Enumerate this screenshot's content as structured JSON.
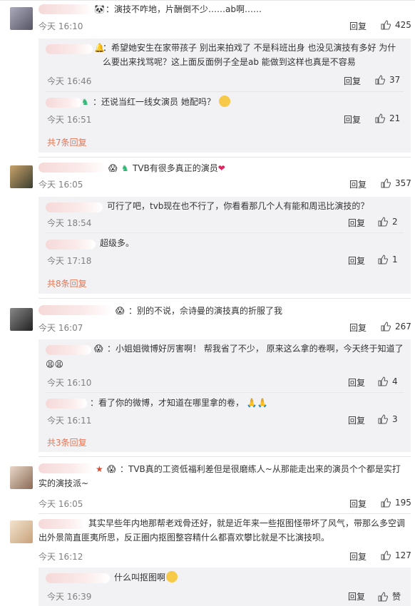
{
  "comments": [
    {
      "text": "：演技不咋地，片酬倒不少……ab啊……",
      "time": "今天 16:10",
      "reply": "回复",
      "likes": "425",
      "replies": [
        {
          "text": "：希望她安生在家带孩子 别出来拍戏了 不是科班出身 也没见演技有多好 为什么要出来找骂呢？这上面反面例子全是ab 能做到这样也真是不容易",
          "time": "今天 16:46",
          "reply": "回复",
          "likes": "37"
        },
        {
          "text": "：还说当红一线女演员 她配吗？",
          "time": "今天 16:51",
          "reply": "回复",
          "likes": "21"
        }
      ],
      "more": "共7条回复"
    },
    {
      "text": "TVB有很多真正的演员",
      "time": "今天 16:05",
      "reply": "回复",
      "likes": "357",
      "replies": [
        {
          "text": "可行了吧，tvb现在也不行了，你看看那几个人有能和周迅比演技的？",
          "time": "今天 18:54",
          "reply": "回复",
          "likes": "2"
        },
        {
          "text": "超级多。",
          "time": "今天 17:18",
          "reply": "回复",
          "likes": "1"
        }
      ],
      "more": "共8条回复"
    },
    {
      "text": "：别的不说，佘诗曼的演技真的折服了我",
      "time": "今天 16:07",
      "reply": "回复",
      "likes": "267",
      "replies": [
        {
          "text": "：小姐姐微博好厉害啊！ 帮我省了不少， 原来这么拿的卷啊，今天终于知道了",
          "time": "今天 16:10",
          "reply": "回复",
          "likes": "4"
        },
        {
          "text": "：看了你的微博，才知道在哪里拿的卷，",
          "time": "今天 16:11",
          "reply": "回复",
          "likes": "3"
        }
      ],
      "more": "共3条回复"
    },
    {
      "text": "：TVB真的工资低福利差但是很磨练人~从那能走出来的演员个个都是实打实的演技派~",
      "time": "今天 16:05",
      "reply": "回复",
      "likes": "195"
    },
    {
      "text": "其实早些年内地那帮老戏骨还好，就是近年来一些抠图怪带坏了风气，带那么多空调出外景简直匪夷所思，反正圈内抠图整容精什么都喜欢攀比就是不比演技呗。",
      "time": "今天 16:12",
      "reply": "回复",
      "likes": "127",
      "replies": [
        {
          "text": "什么叫抠图啊",
          "time": "今天 16:39",
          "reply": "回复",
          "likes": "赞"
        }
      ]
    }
  ]
}
